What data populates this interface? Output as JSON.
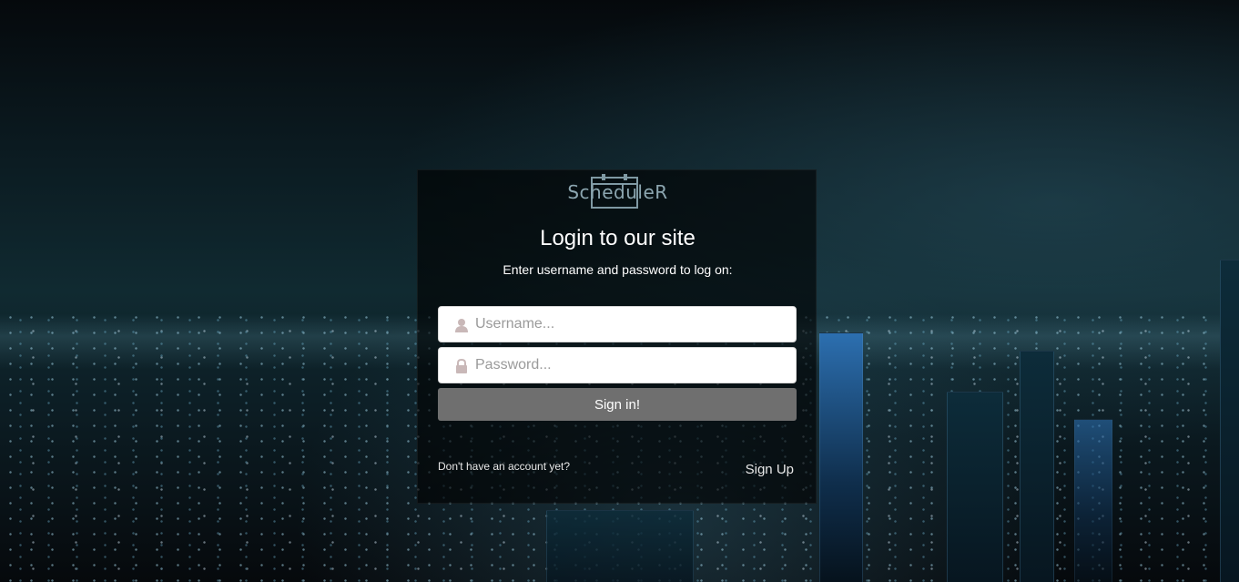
{
  "brand": {
    "name": "ScheduleR",
    "icon": "calendar-icon",
    "color": "#8ca6b0"
  },
  "login": {
    "title": "Login to our site",
    "subtitle": "Enter username and password to log on:",
    "username": {
      "placeholder": "Username...",
      "value": "",
      "icon": "user-icon"
    },
    "password": {
      "placeholder": "Password...",
      "value": "",
      "icon": "lock-icon"
    },
    "submit_label": "Sign in!",
    "no_account_text": "Don't have an account yet?",
    "signup_label": "Sign Up"
  },
  "colors": {
    "button": "#6f6f6f",
    "card": "rgba(0,0,0,0.62)",
    "icon": "#c9b8b8"
  }
}
